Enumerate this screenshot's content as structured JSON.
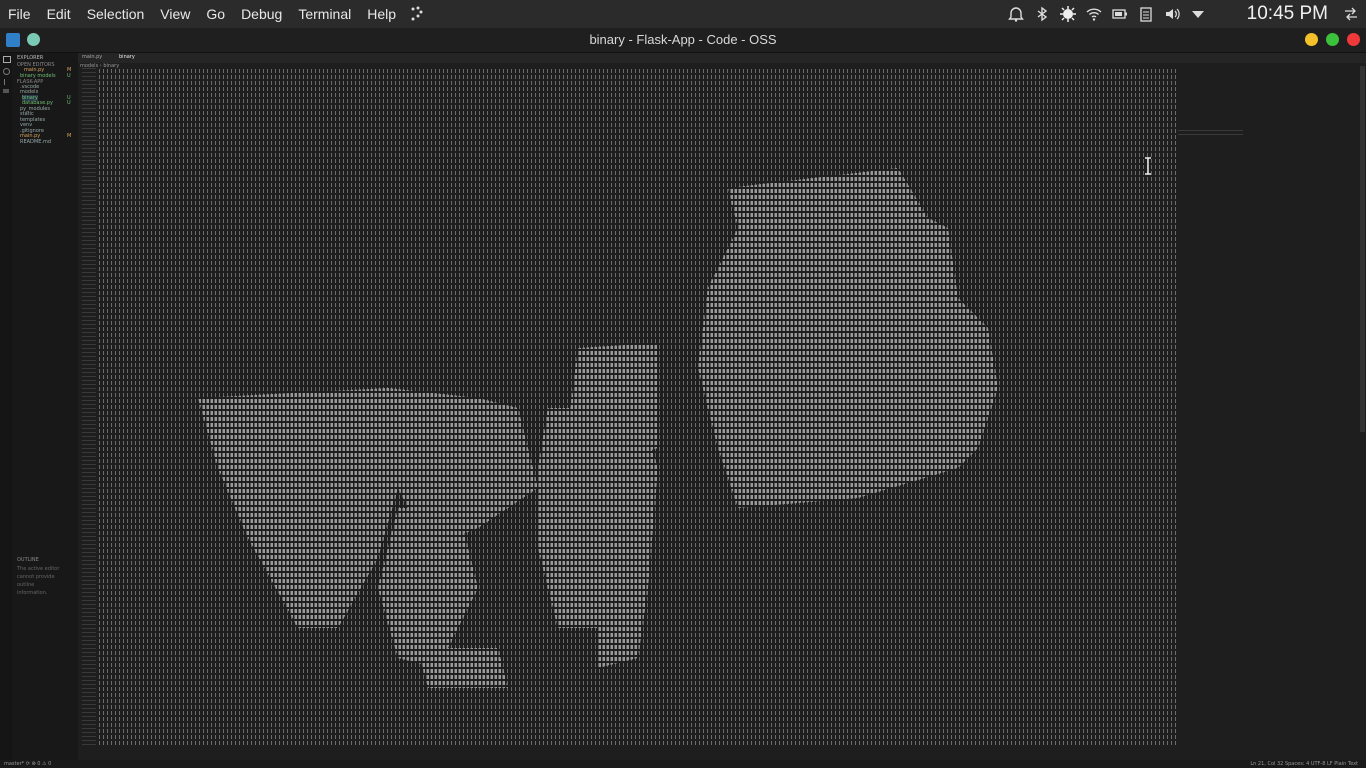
{
  "system_bar": {
    "menus": [
      "File",
      "Edit",
      "Selection",
      "View",
      "Go",
      "Debug",
      "Terminal",
      "Help"
    ],
    "tray_icons": [
      "alarm-icon",
      "bluetooth-icon",
      "brightness-icon",
      "wifi-icon",
      "battery-icon",
      "clipboard-icon",
      "volume-icon",
      "dropdown-arrow-icon",
      "network-settings-icon"
    ],
    "clock": "10:45 PM"
  },
  "window": {
    "title": "binary - Flask-App - Code - OSS",
    "controls": {
      "minimize_color": "#f5c12a",
      "maximize_color": "#3cc13c",
      "close_color": "#f03a3a"
    }
  },
  "explorer": {
    "header": "EXPLORER",
    "open_editors_label": "OPEN EDITORS",
    "open_editors": [
      {
        "name": "main.py",
        "badge": "M"
      },
      {
        "name": "binary models",
        "badge": "U"
      }
    ],
    "project_label": "FLASK-APP",
    "tree": [
      {
        "name": ".vscode",
        "badge": ""
      },
      {
        "name": "models",
        "badge": ""
      },
      {
        "name": "binary",
        "badge": "U"
      },
      {
        "name": "database.py",
        "badge": "U"
      },
      {
        "name": "py_modules",
        "badge": ""
      },
      {
        "name": "static",
        "badge": ""
      },
      {
        "name": "templates",
        "badge": ""
      },
      {
        "name": "venv",
        "badge": ""
      },
      {
        "name": ".gitignore",
        "badge": ""
      },
      {
        "name": "main.py",
        "badge": "M"
      },
      {
        "name": "README.md",
        "badge": ""
      }
    ],
    "outline_label": "OUTLINE",
    "outline_message": [
      "The active editor",
      "cannot provide",
      "outline",
      "information."
    ]
  },
  "editor": {
    "tabs": [
      "main.py",
      "binary"
    ],
    "breadcrumb": "models › binary"
  },
  "status_bar": {
    "left": "master* ⟳ ⊗ 0 ⚠ 0",
    "right": "Ln 21, Col 32   Spaces: 4   UTF-8   LF   Plain Text"
  },
  "colors": {
    "badge_modified": "#d8a85a",
    "badge_untracked": "#6fbf73"
  }
}
